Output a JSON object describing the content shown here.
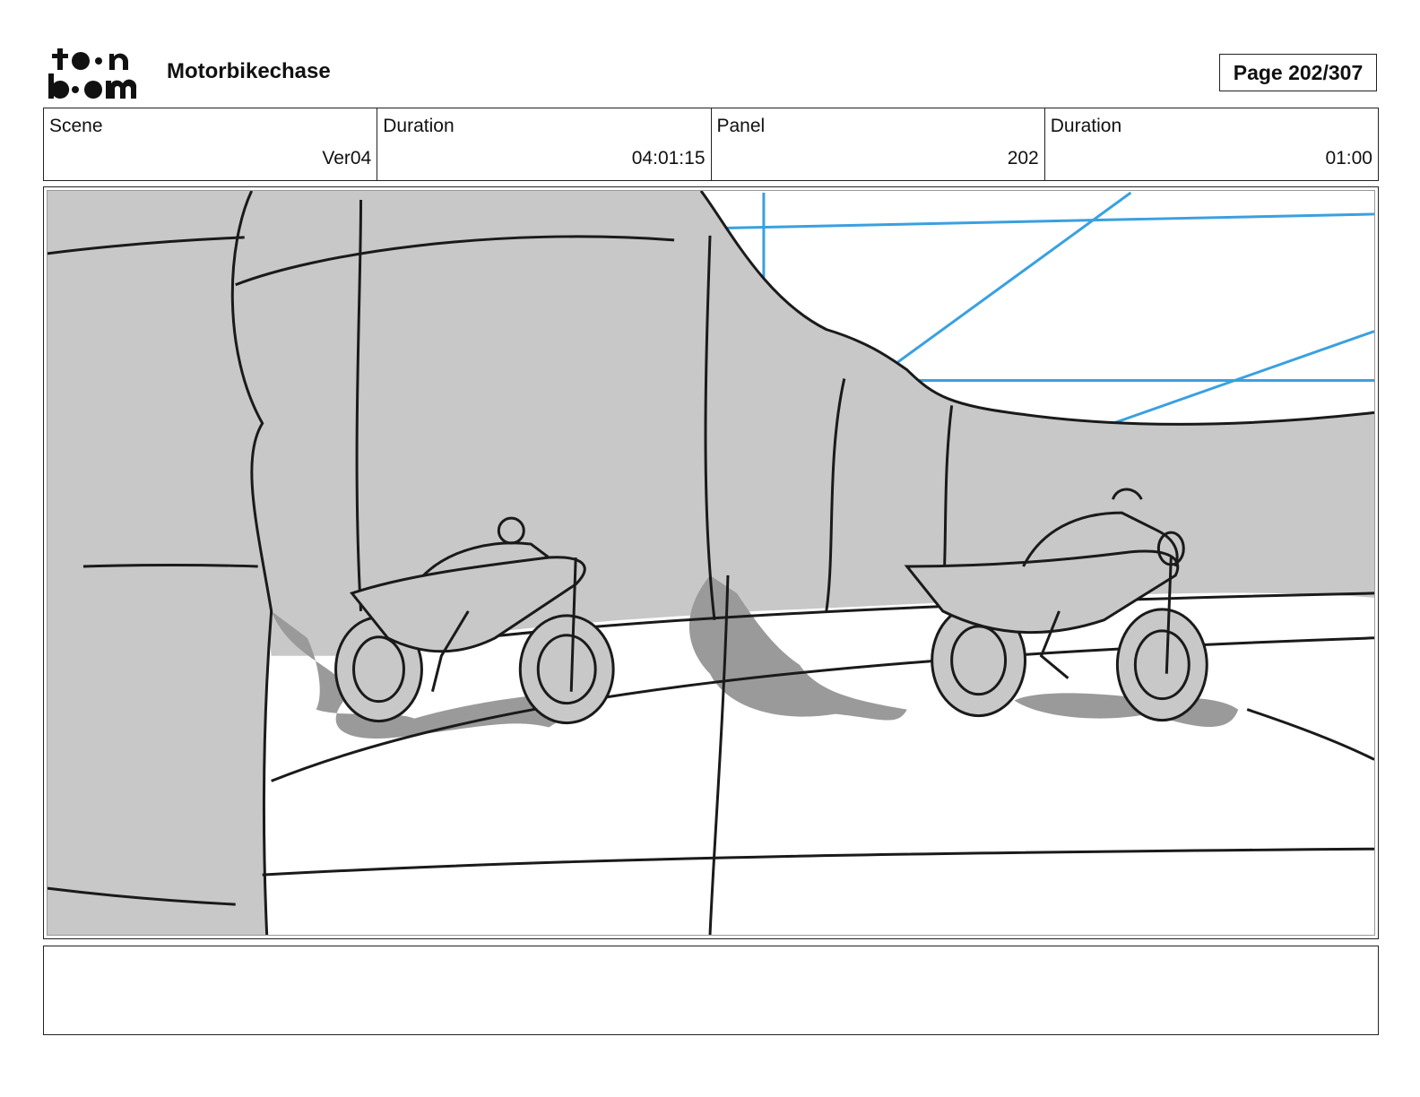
{
  "header": {
    "logo_text": "toonboom",
    "project_title": "Motorbikechase",
    "page_label": "Page 202/307"
  },
  "info": {
    "scene_label": "Scene",
    "scene_value": "Ver04",
    "scene_duration_label": "Duration",
    "scene_duration_value": "04:01:15",
    "panel_label": "Panel",
    "panel_value": "202",
    "panel_duration_label": "Duration",
    "panel_duration_value": "01:00"
  },
  "panel": {
    "image_icon": "storyboard-sketch-image",
    "colors": {
      "rock": "#c8c8c8",
      "ground_shadow": "#9a9a9a",
      "ink": "#1a1a1a",
      "guide_line": "#3aa0e0"
    }
  },
  "notes": {
    "text": ""
  }
}
